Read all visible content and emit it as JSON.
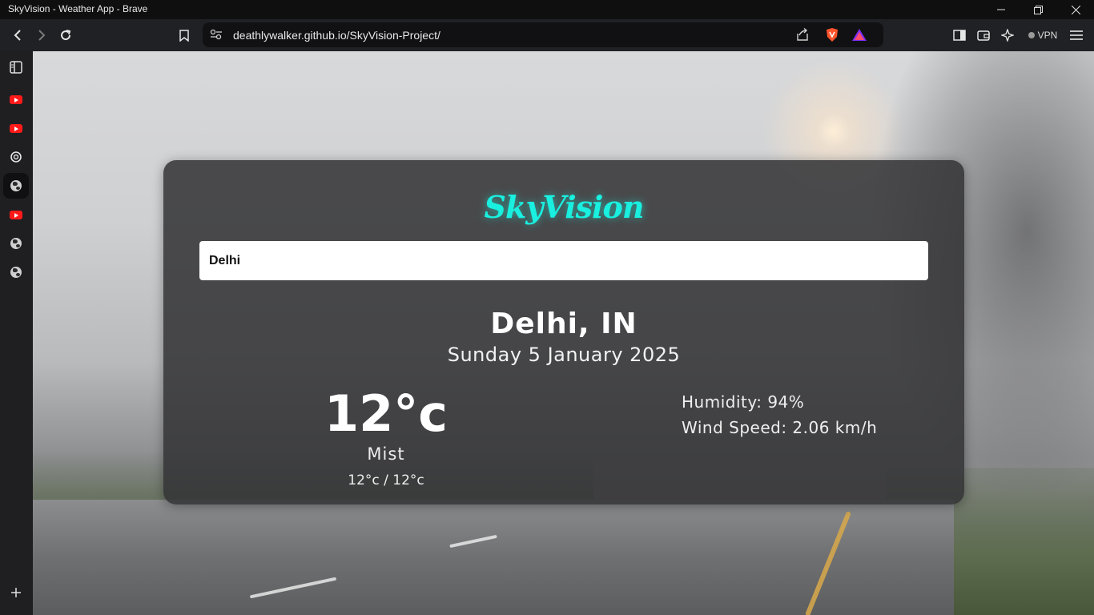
{
  "window": {
    "title": "SkyVision - Weather App - Brave"
  },
  "browser": {
    "url": "deathlywalker.github.io/SkyVision-Project/",
    "vpn_label": "VPN"
  },
  "sidebar": {
    "items": [
      {
        "icon": "sidebar-toggle-icon"
      },
      {
        "icon": "youtube-icon"
      },
      {
        "icon": "youtube-icon"
      },
      {
        "icon": "chatgpt-icon"
      },
      {
        "icon": "globe-icon",
        "active": true
      },
      {
        "icon": "youtube-icon"
      },
      {
        "icon": "globe-icon"
      },
      {
        "icon": "globe-icon"
      }
    ],
    "add_icon": "plus-icon"
  },
  "app": {
    "logo_text": "SkyVision",
    "accent_color": "#19f0e0",
    "search_value": "Delhi",
    "city": "Delhi, IN",
    "date": "Sunday 5 January 2025",
    "temperature": "12°c",
    "condition": "Mist",
    "min_max": "12°c / 12°c",
    "humidity": "Humidity: 94%",
    "wind": "Wind Speed: 2.06 km/h"
  }
}
